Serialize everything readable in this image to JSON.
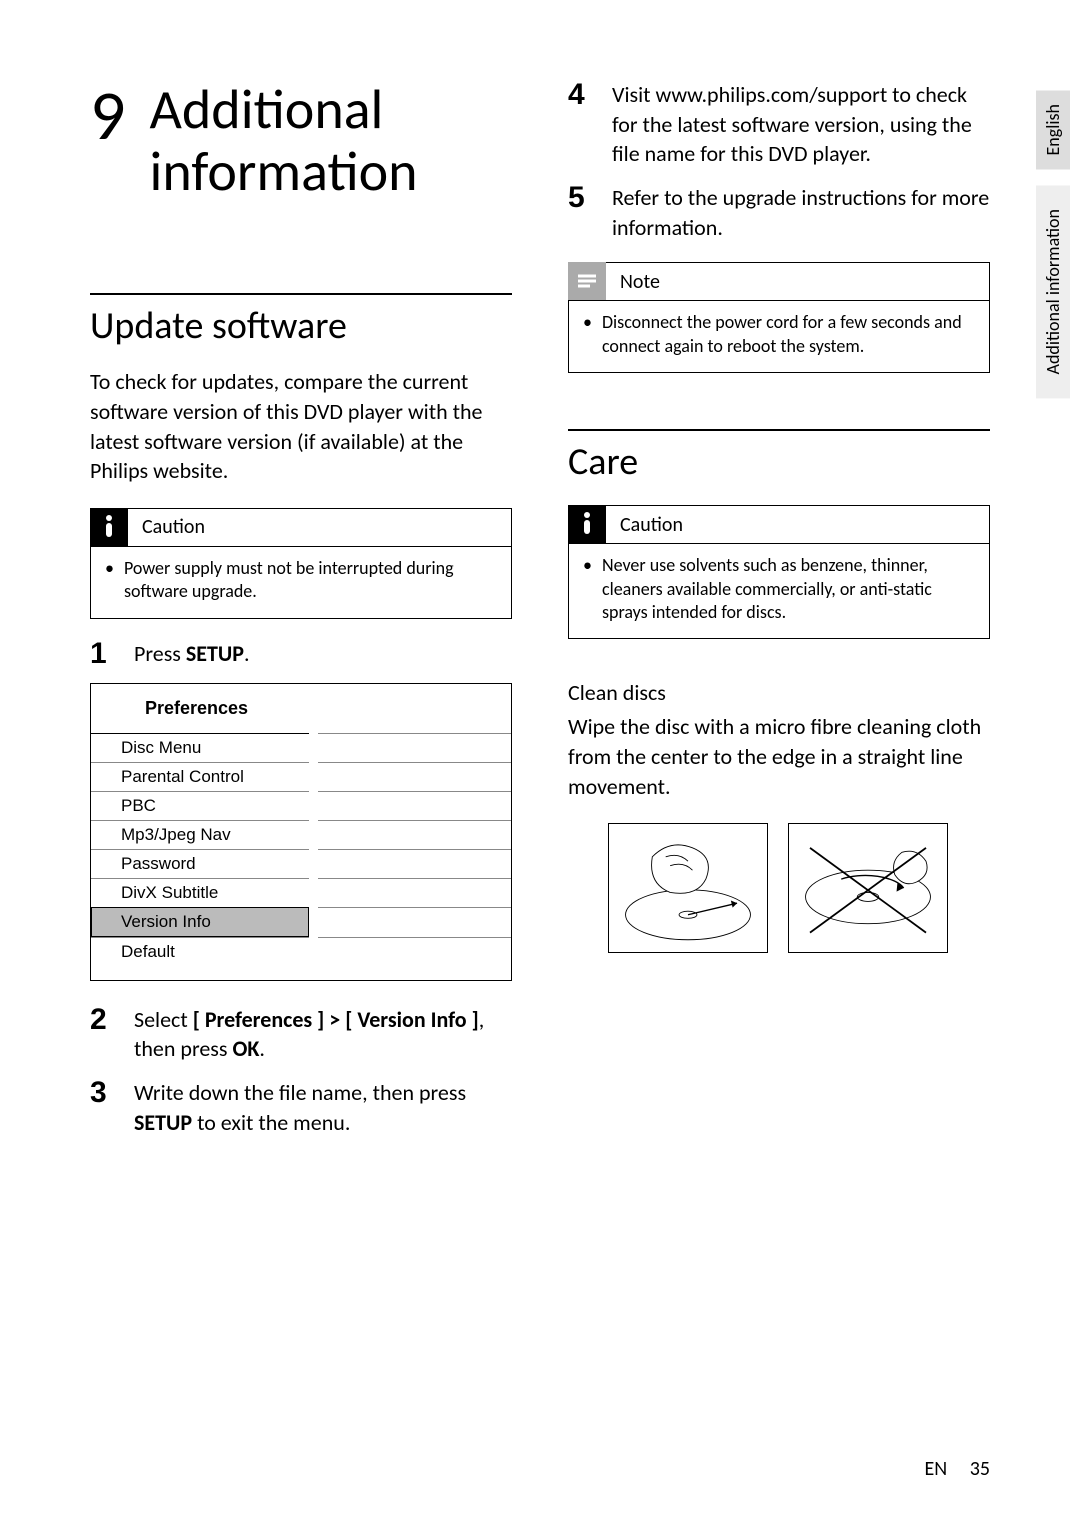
{
  "chapter": {
    "number": "9",
    "title": "Additional information"
  },
  "side_tabs": {
    "lang": "English",
    "section": "Additional information"
  },
  "left": {
    "section_title": "Update software",
    "intro": "To check for updates, compare the current software version of this DVD player with the latest software version (if available) at the Philips website.",
    "caution": {
      "label": "Caution",
      "text": "Power supply must not be interrupted during software upgrade."
    },
    "step1": {
      "num": "1",
      "pre": "Press ",
      "btn": "SETUP",
      "post": "."
    },
    "menu": {
      "title": "Preferences",
      "items": [
        "Disc Menu",
        "Parental Control",
        "PBC",
        "Mp3/Jpeg Nav",
        "Password",
        "DivX Subtitle",
        "Version Info",
        "Default"
      ],
      "selected_index": 6
    },
    "step2": {
      "num": "2",
      "pre": "Select ",
      "path": "[ Preferences ] > [ Version Info ]",
      "mid": ", then press ",
      "btn": "OK",
      "post": "."
    },
    "step3": {
      "num": "3",
      "pre": "Write down the file name, then press ",
      "btn": "SETUP",
      "post": " to exit the menu."
    }
  },
  "right": {
    "step4": {
      "num": "4",
      "text_a": "Visit www.philips.com/support to check for the latest software version, using the file name for this DVD player."
    },
    "step5": {
      "num": "5",
      "text": "Refer to the upgrade instructions for more information."
    },
    "note": {
      "label": "Note",
      "text": "Disconnect the power cord for a few seconds and connect again to reboot the system."
    },
    "care_title": "Care",
    "care_caution": {
      "label": "Caution",
      "text": "Never use solvents such as benzene, thinner, cleaners available commercially, or anti-static sprays intended for discs."
    },
    "clean_heading": "Clean discs",
    "clean_text": "Wipe the disc with a micro fibre cleaning cloth from the center to the edge in a straight line movement."
  },
  "footer": {
    "lang": "EN",
    "page": "35"
  }
}
